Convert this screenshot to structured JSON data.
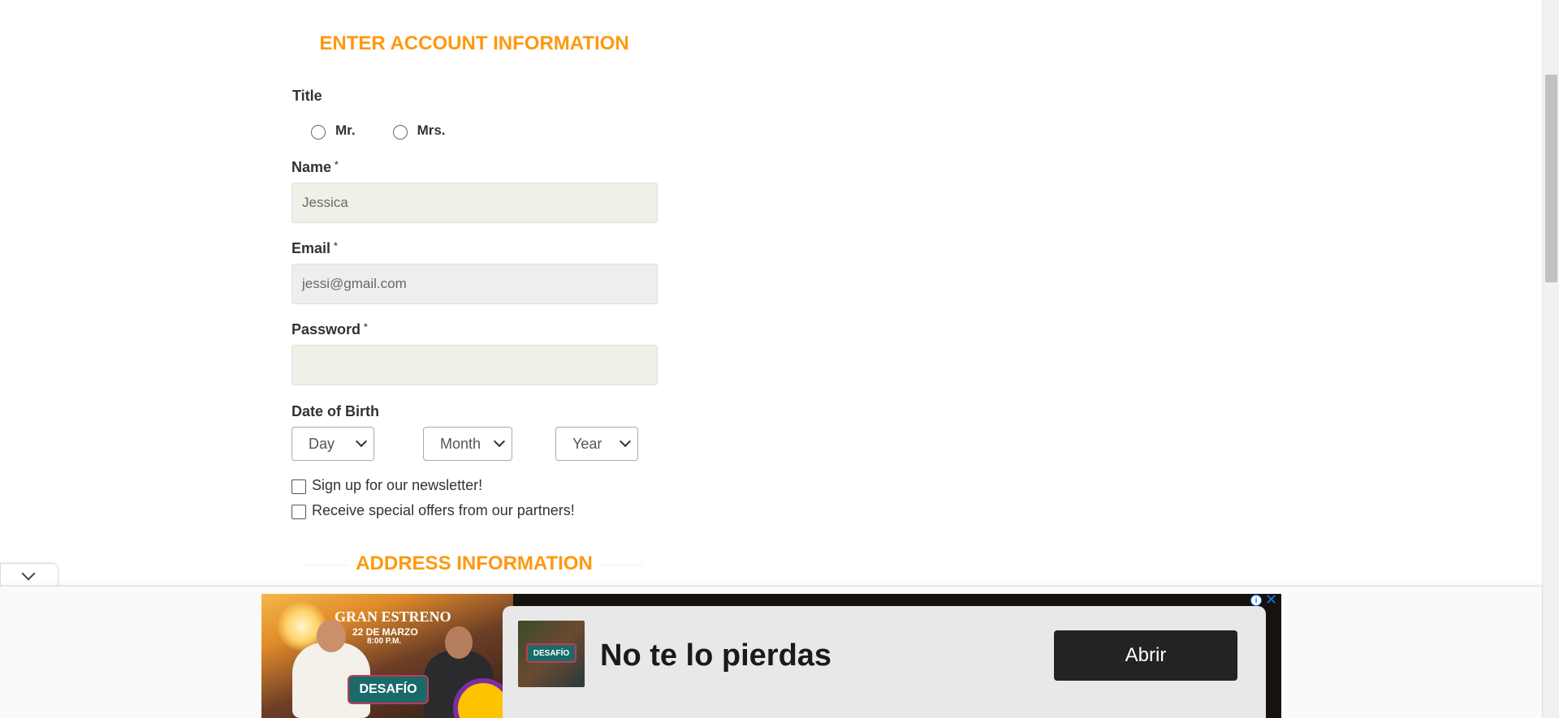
{
  "form": {
    "heading": "ENTER ACCOUNT INFORMATION",
    "title_label": "Title",
    "title_options": [
      "Mr.",
      "Mrs."
    ],
    "name_label": "Name",
    "name_value": "Jessica",
    "email_label": "Email",
    "email_value": "jessi@gmail.com",
    "password_label": "Password",
    "password_value": "",
    "required_marker": "*",
    "dob_label": "Date of Birth",
    "dob_day": "Day",
    "dob_month": "Month",
    "dob_year": "Year",
    "newsletter_label": "Sign up for our newsletter!",
    "offers_label": "Receive special offers from our partners!",
    "address_heading": "ADDRESS INFORMATION"
  },
  "ad": {
    "image_title": "GRAN ESTRENO",
    "image_date": "22 DE MARZO",
    "image_time": "8:00 P.M.",
    "image_logo": "DESAFÍO",
    "thumb_logo": "DESAFÍO",
    "headline": "No te lo pierdas",
    "cta": "Abrir",
    "info_icon": "i",
    "close_icon": "✕"
  },
  "colors": {
    "accent": "#FE980F",
    "input_beige": "#F0F0E9",
    "input_grey": "#EEEEEE",
    "ad_cta": "#232323"
  }
}
